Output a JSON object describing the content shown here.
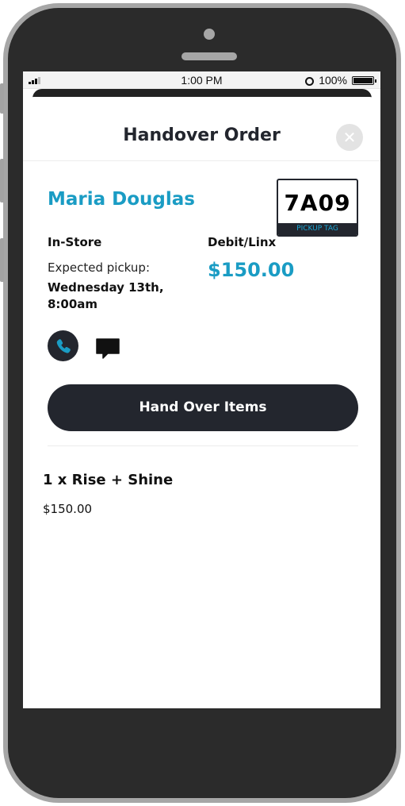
{
  "status_bar": {
    "time": "1:00 PM",
    "battery_percent": "100%"
  },
  "modal": {
    "title": "Handover Order",
    "close_icon": "close-icon"
  },
  "order": {
    "customer_name": "Maria Douglas",
    "pickup_tag": {
      "code": "7A09",
      "label": "PICKUP TAG"
    },
    "order_type": "In-Store",
    "payment_method": "Debit/Linx",
    "expected_label": "Expected pickup:",
    "expected_date": "Wednesday 13th, 8:00am",
    "amount": "$150.00"
  },
  "actions": {
    "call_icon": "phone-icon",
    "message_icon": "message-icon",
    "handover_label": "Hand Over Items"
  },
  "items": [
    {
      "title": "1 x Rise + Shine",
      "price": "$150.00"
    }
  ],
  "colors": {
    "accent": "#1a9cc4",
    "dark": "#23262e",
    "pickup_label": "#1aa8d8"
  }
}
